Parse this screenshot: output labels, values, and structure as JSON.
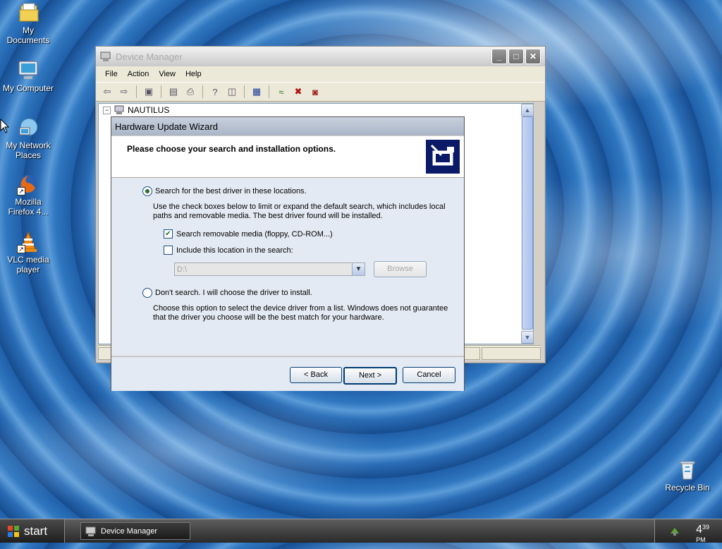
{
  "desktop": {
    "icons": [
      {
        "label": "My Documents",
        "icon": "my-documents-icon"
      },
      {
        "label": "My Computer",
        "icon": "my-computer-icon"
      },
      {
        "label": "My Network Places",
        "icon": "my-network-places-icon"
      },
      {
        "label": "Mozilla Firefox 4...",
        "icon": "firefox-icon"
      },
      {
        "label": "VLC media player",
        "icon": "vlc-icon"
      },
      {
        "label": "Recycle Bin",
        "icon": "recycle-bin-icon"
      }
    ]
  },
  "device_manager": {
    "title": "Device Manager",
    "menu": [
      "File",
      "Action",
      "View",
      "Help"
    ],
    "tree_root": "NAUTILUS",
    "tree_expander": "−"
  },
  "wizard": {
    "title": "Hardware Update Wizard",
    "header": "Please choose your search and installation options.",
    "option_search": {
      "label": "Search for the best driver in these locations.",
      "selected": true,
      "description": "Use the check boxes below to limit or expand the default search, which includes local paths and removable media. The best driver found will be installed."
    },
    "check_removable": {
      "label": "Search removable media (floppy, CD-ROM...)",
      "checked": true
    },
    "check_location": {
      "label": "Include this location in the search:",
      "checked": false
    },
    "location_value": "D:\\",
    "browse_label": "Browse",
    "option_dont_search": {
      "label": "Don't search. I will choose the driver to install.",
      "selected": false,
      "description": "Choose this option to select the device driver from a list.  Windows does not guarantee that the driver you choose will be the best match for your hardware."
    },
    "back_label": "< Back",
    "next_label": "Next >",
    "cancel_label": "Cancel"
  },
  "taskbar": {
    "start_label": "start",
    "task_item": "Device Manager",
    "clock_hour": "4",
    "clock_minutes": "39",
    "clock_ampm": "PM"
  },
  "colors": {
    "wizard_header_icon_bg": "#0a1a66",
    "wizard_body_bg": "#e4eaf3",
    "button_border": "#003c74"
  }
}
